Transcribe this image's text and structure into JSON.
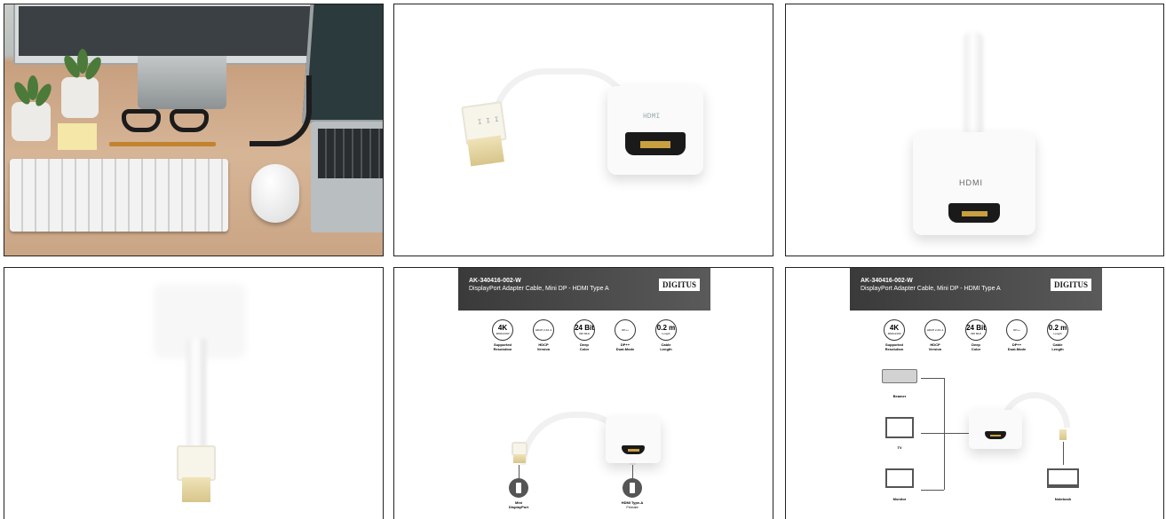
{
  "gallery": {
    "images": [
      {
        "alt": "Desk scene with monitor, laptop and adapter"
      },
      {
        "alt": "Mini DP to HDMI adapter cable",
        "hdmi_engraving": "HDMI",
        "mdp_engraving": "I I I"
      },
      {
        "alt": "Adapter HDMI female port",
        "port_label": "HDMI"
      },
      {
        "alt": "Adapter Mini DisplayPort connector"
      },
      {
        "alt": "Datasheet connectors"
      },
      {
        "alt": "Datasheet usage diagram"
      }
    ]
  },
  "datasheet": {
    "sku": "AK-340416-002-W",
    "subtitle": "DisplayPort Adapter Cable, Mini DP - HDMI Type A",
    "brand": "DIGITUS",
    "features": [
      {
        "big": "4K",
        "small": "3840x2160",
        "label_line1": "Supported",
        "label_line2": "Resolution"
      },
      {
        "big": "",
        "small": "HDCP 2.2/1.4",
        "label_line1": "HDCP",
        "label_line2": "Version"
      },
      {
        "big": "24 Bit",
        "small": "330 MHz",
        "label_line1": "Deep",
        "label_line2": "Color"
      },
      {
        "big": "",
        "small": "DP++",
        "label_line1": "DP++",
        "label_line2": "Dual-Mode"
      },
      {
        "big": "0.2 m",
        "small": "Length",
        "label_line1": "Cable",
        "label_line2": "Length"
      }
    ],
    "connectors": {
      "left_line1": "Mini",
      "left_line2": "DisplayPort",
      "right_line1": "HDMI Type-A",
      "right_line2": "Female"
    },
    "devices": {
      "beamer": "Beamer",
      "tv": "TV",
      "monitor": "Monitor",
      "notebook": "Notebook"
    }
  }
}
